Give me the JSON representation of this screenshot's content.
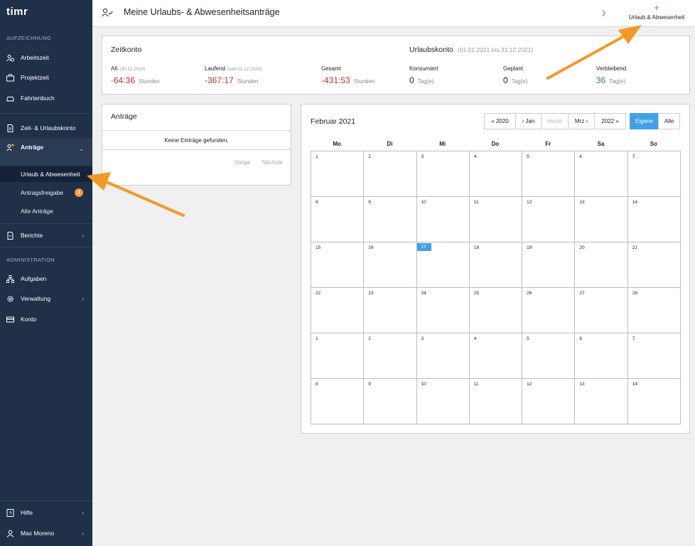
{
  "app": {
    "logo_text": "timr"
  },
  "sidebar": {
    "section_recording": "AUFZEICHNUNG",
    "section_admin": "ADMINISTRATION",
    "items": {
      "arbeitszeit": "Arbeitszeit",
      "projektzeit": "Projektzeit",
      "fahrtenbuch": "Fahrtenbuch",
      "zeitkonto": "Zeit- & Urlaubskonto",
      "antraege": "Anträge",
      "berichte": "Berichte",
      "aufgaben": "Aufgaben",
      "verwaltung": "Verwaltung",
      "konto": "Konto",
      "hilfe": "Hilfe",
      "user": "Max Moreno"
    },
    "sub_items": {
      "urlaub": "Urlaub & Abwesenheit",
      "freigabe": "Antragsfreigabe",
      "freigabe_count": "3",
      "alle": "Alle Anträge"
    }
  },
  "header": {
    "title": "Meine Urlaubs- & Abwesenheitsanträge",
    "add_plus": "+",
    "add_label": "Urlaub & Abwesenheit"
  },
  "zeitkonto": {
    "title": "Zeitkonto",
    "alt_label": "Alt",
    "alt_date": "(30.11.2020)",
    "alt_value": "-64:36",
    "laufend_label": "Laufend",
    "laufend_date": "(seit 01.12.2020)",
    "laufend_value": "-367:17",
    "gesamt_label": "Gesamt",
    "gesamt_value": "-431:53",
    "unit": "Stunden"
  },
  "urlaubskonto": {
    "title": "Urlaubskonto",
    "period": "(01.01.2021 bis 31.12.2021)",
    "konsumiert_label": "Konsumiert",
    "konsumiert_value": "0",
    "geplant_label": "Geplant",
    "geplant_value": "0",
    "verbleibend_label": "Verbleibend",
    "verbleibend_value": "36",
    "unit": "Tag(e)"
  },
  "antraege": {
    "title": "Anträge",
    "empty": "Keine Einträge gefunden.",
    "prev": "Vorige",
    "next": "Nächste"
  },
  "calendar": {
    "title": "Februar 2021",
    "nav": {
      "prev_year": "« 2020",
      "prev_month": "‹ Jan",
      "today": "Heute",
      "next_month": "Mrz ›",
      "next_year": "2022 »"
    },
    "filter": {
      "own": "Eigene",
      "all": "Alle"
    },
    "weekdays": [
      "Mo",
      "Di",
      "Mi",
      "Do",
      "Fr",
      "Sa",
      "So"
    ],
    "days": [
      "1",
      "2",
      "3",
      "4",
      "5",
      "6",
      "7",
      "8",
      "9",
      "10",
      "11",
      "12",
      "13",
      "14",
      "15",
      "16",
      "17",
      "18",
      "19",
      "20",
      "21",
      "22",
      "23",
      "24",
      "25",
      "26",
      "27",
      "28",
      "1",
      "2",
      "3",
      "4",
      "5",
      "6",
      "7",
      "8",
      "9",
      "10",
      "11",
      "12",
      "13",
      "14"
    ],
    "today": "17"
  },
  "colors": {
    "sidebar_bg": "#1f3048",
    "accent": "#41a0e8",
    "negative": "#c9302c",
    "positive": "#3d8b3d",
    "badge": "#f59a23",
    "annotation_arrow": "#f39a26"
  }
}
